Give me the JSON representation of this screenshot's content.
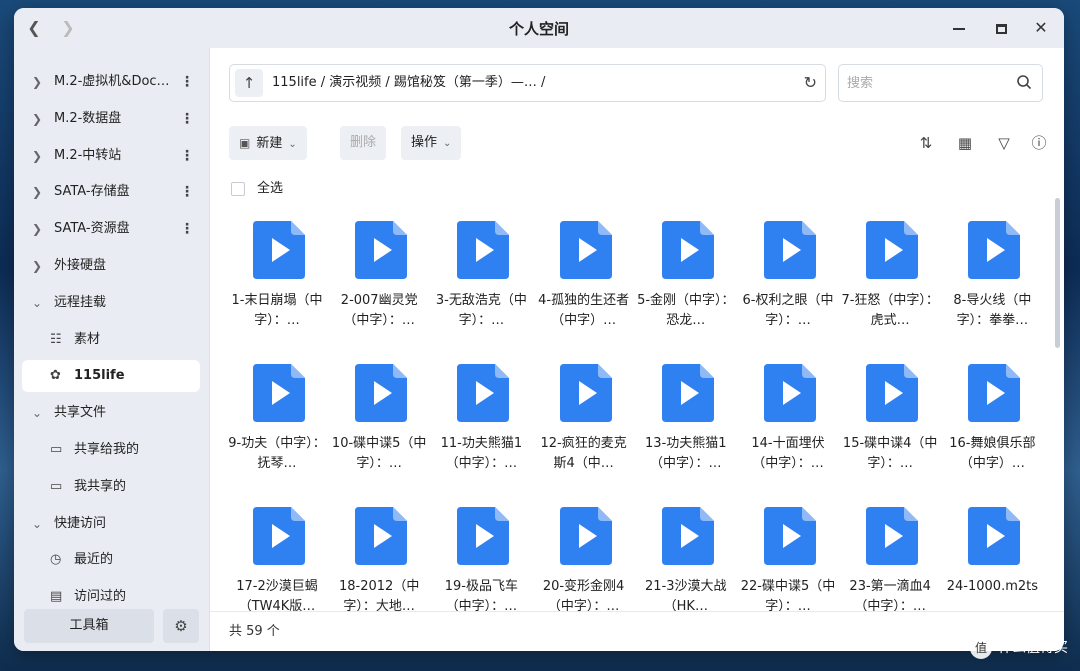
{
  "window": {
    "title": "个人空间",
    "back_icon": "chevron-left-icon",
    "forward_icon": "chevron-right-icon"
  },
  "sidebar": {
    "items": [
      {
        "label": "M.2-虚拟机&Doc…",
        "type": "group",
        "expanded": false,
        "has_menu": true
      },
      {
        "label": "M.2-数据盘",
        "type": "group",
        "expanded": false,
        "has_menu": true
      },
      {
        "label": "M.2-中转站",
        "type": "group",
        "expanded": false,
        "has_menu": true
      },
      {
        "label": "SATA-存储盘",
        "type": "group",
        "expanded": false,
        "has_menu": true
      },
      {
        "label": "SATA-资源盘",
        "type": "group",
        "expanded": false,
        "has_menu": true
      },
      {
        "label": "外接硬盘",
        "type": "group",
        "expanded": false,
        "has_menu": false
      },
      {
        "label": "远程挂载",
        "type": "group",
        "expanded": true,
        "has_menu": false
      },
      {
        "label": "素材",
        "type": "child",
        "icon": "network-icon"
      },
      {
        "label": "115life",
        "type": "child",
        "icon": "cloud-icon",
        "active": true
      },
      {
        "label": "共享文件",
        "type": "group",
        "expanded": true,
        "has_menu": false
      },
      {
        "label": "共享给我的",
        "type": "child",
        "icon": "share-in-icon"
      },
      {
        "label": "我共享的",
        "type": "child",
        "icon": "share-out-icon"
      },
      {
        "label": "快捷访问",
        "type": "group",
        "expanded": true,
        "has_menu": false
      },
      {
        "label": "最近的",
        "type": "child",
        "icon": "clock-icon"
      },
      {
        "label": "访问过的",
        "type": "child",
        "icon": "history-icon"
      }
    ],
    "toolbox_label": "工具箱"
  },
  "pathbar": {
    "breadcrumb": "115life / 演示视频 / 踢馆秘笈（第一季）—…    /"
  },
  "search": {
    "placeholder": "搜索",
    "value": ""
  },
  "toolbar": {
    "new_label": "新建",
    "delete_label": "删除",
    "action_label": "操作"
  },
  "select_all_label": "全选",
  "files": [
    "1-末日崩塌（中字）：…",
    "2-007幽灵党（中字）：…",
    "3-无敌浩克（中字）：…",
    "4-孤独的生还者（中字）…",
    "5-金刚（中字）：恐龙…",
    "6-权利之眼（中字）：…",
    "7-狂怒（中字）：虎式…",
    "8-导火线（中字）：拳拳…",
    "9-功夫（中字）：抚琴…",
    "10-碟中谍5（中字）：…",
    "11-功夫熊猫1（中字）：…",
    "12-疯狂的麦克斯4（中…",
    "13-功夫熊猫1（中字）：…",
    "14-十面埋伏（中字）：…",
    "15-碟中谍4（中字）：…",
    "16-舞娘俱乐部（中字）…",
    "17-2沙漠巨蝎（TW4K版…",
    "18-2012（中字）：大地…",
    "19-极品飞车（中字）：…",
    "20-变形金刚4（中字）：…",
    "21-3沙漠大战（HK…",
    "22-碟中谍5（中字）：…",
    "23-第一滴血4（中字）：…",
    "24-1000.m2ts"
  ],
  "status": {
    "count_label": "共 59 个"
  },
  "watermark": "值 什么值得买",
  "colors": {
    "file_icon": "#2f80f0",
    "file_icon_fold": "#8fbaf7",
    "sidebar_bg": "#e9edf3"
  }
}
